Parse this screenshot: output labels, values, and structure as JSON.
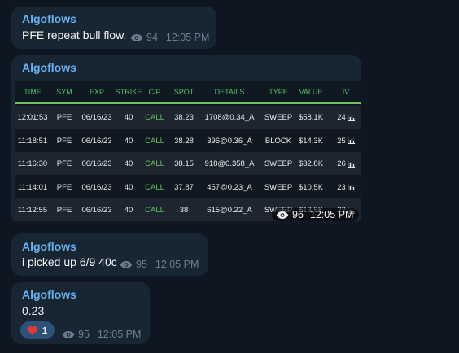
{
  "messages": [
    {
      "sender": "Algoflows",
      "text": "PFE repeat bull flow.",
      "views": "94",
      "time": "12:05 PM"
    },
    {
      "sender": "Algoflows",
      "views": "96",
      "time": "12:05 PM",
      "table": {
        "headers": [
          "TIME",
          "SYM",
          "EXP",
          "STRIKE",
          "C/P",
          "SPOT",
          "DETAILS",
          "TYPE",
          "VALUE",
          "IV"
        ],
        "rows": [
          [
            "12:01:53",
            "PFE",
            "06/16/23",
            "40",
            "CALL",
            "38.23",
            "1708@0.34_A",
            "SWEEP",
            "$58.1K",
            "24"
          ],
          [
            "11:18:51",
            "PFE",
            "06/16/23",
            "40",
            "CALL",
            "38.28",
            "396@0.36_A",
            "BLOCK",
            "$14.3K",
            "25"
          ],
          [
            "11:16:30",
            "PFE",
            "06/16/23",
            "40",
            "CALL",
            "38.15",
            "918@0.358_A",
            "SWEEP",
            "$32.8K",
            "26"
          ],
          [
            "11:14:01",
            "PFE",
            "06/16/23",
            "40",
            "CALL",
            "37.87",
            "457@0.23_A",
            "SWEEP",
            "$10.5K",
            "23"
          ],
          [
            "11:12:55",
            "PFE",
            "06/16/23",
            "40",
            "CALL",
            "38",
            "615@0.22_A",
            "SWEEP",
            "$13.5K",
            "22"
          ]
        ]
      }
    },
    {
      "sender": "Algoflows",
      "text": "i picked up 6/9 40c",
      "views": "95",
      "time": "12:05 PM"
    },
    {
      "sender": "Algoflows",
      "text": "0.23",
      "reaction": {
        "emoji_icon": "heart-icon",
        "count": "1"
      },
      "views": "95",
      "time": "12:05 PM"
    }
  ],
  "colors": {
    "background": "#0e1621",
    "bubble": "#182533",
    "sender": "#6ab3f3",
    "header_text": "#4fbf6a",
    "header_rule": "#70c15a",
    "call": "#63c35b",
    "reaction_bg": "#2b5278",
    "heart": "#e53935"
  }
}
